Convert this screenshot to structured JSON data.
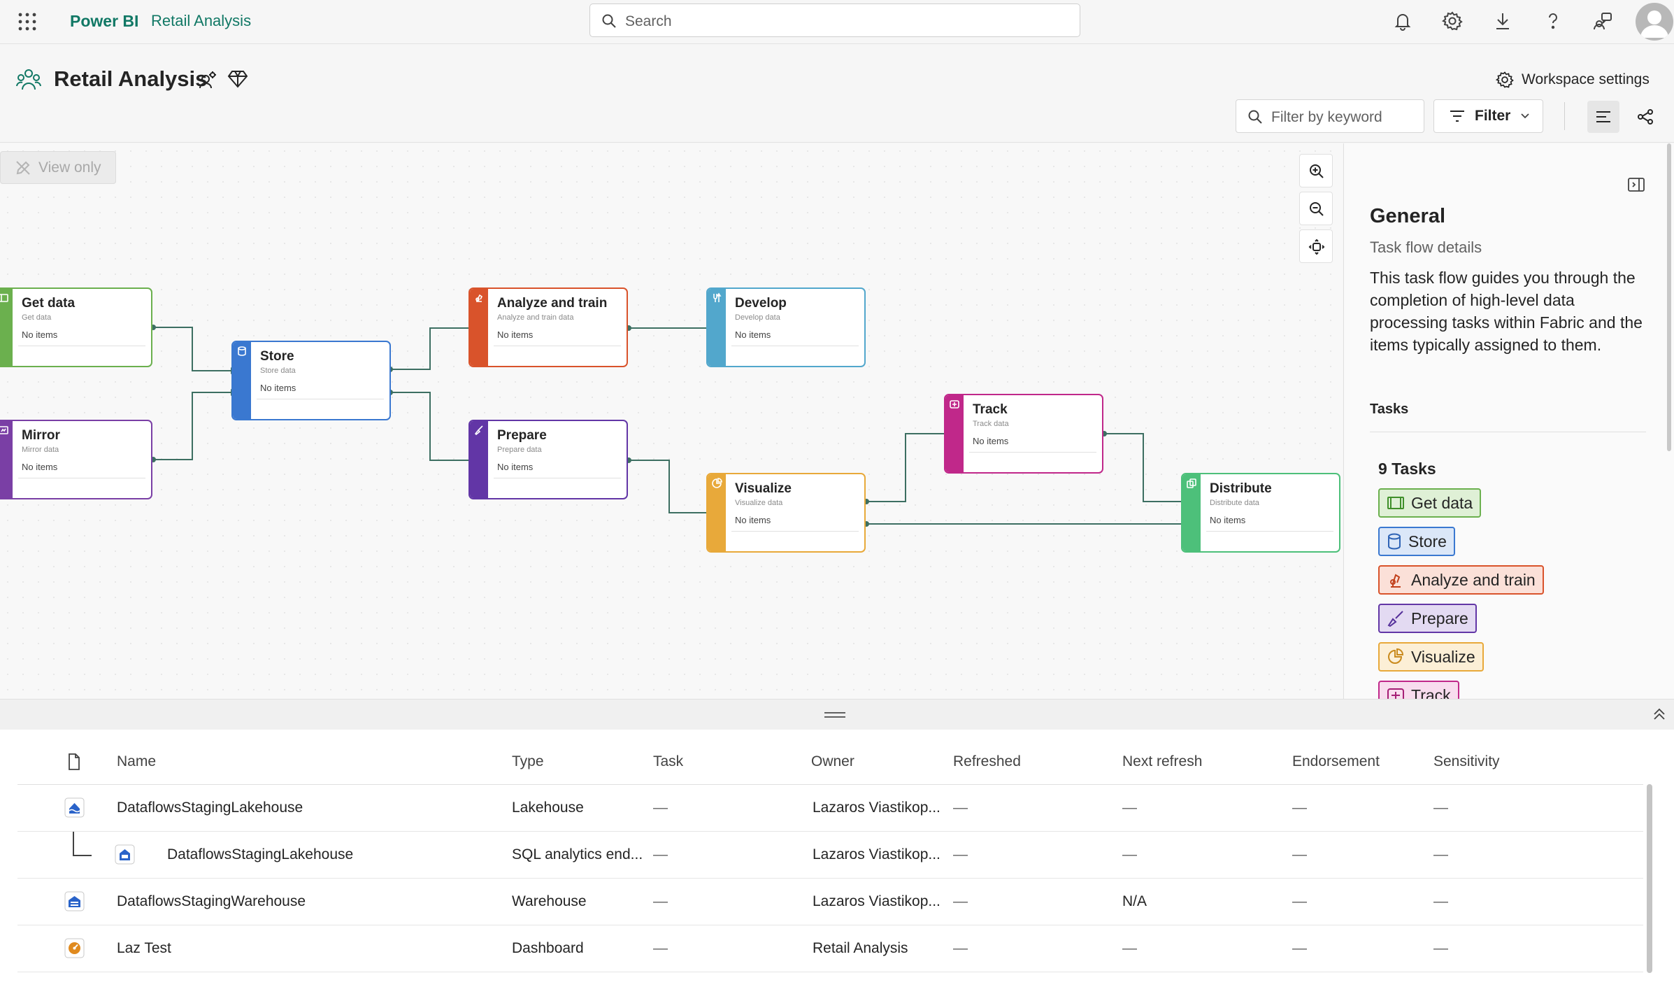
{
  "app": {
    "brand": "Power BI",
    "workspace": "Retail Analysis"
  },
  "search": {
    "placeholder": "Search"
  },
  "header": {
    "title": "Retail Analysis",
    "workspace_settings": "Workspace settings",
    "filter_placeholder": "Filter by keyword",
    "filter_label": "Filter"
  },
  "canvas": {
    "view_only": "View only",
    "tasks": [
      {
        "name": "Get data",
        "subtitle": "Get data",
        "items": "No items",
        "color": "#6bb04e",
        "icon": "get-data-icon"
      },
      {
        "name": "Mirror",
        "subtitle": "Mirror data",
        "items": "No items",
        "color": "#7a3fa5",
        "icon": "mirror-icon"
      },
      {
        "name": "Store",
        "subtitle": "Store data",
        "items": "No items",
        "color": "#3a78d0",
        "icon": "store-icon"
      },
      {
        "name": "Analyze and train",
        "subtitle": "Analyze and train data",
        "items": "No items",
        "color": "#d9532b",
        "icon": "analyze-icon"
      },
      {
        "name": "Prepare",
        "subtitle": "Prepare data",
        "items": "No items",
        "color": "#6236a6",
        "icon": "prepare-icon"
      },
      {
        "name": "Develop",
        "subtitle": "Develop data",
        "items": "No items",
        "color": "#52a7cc",
        "icon": "develop-icon"
      },
      {
        "name": "Visualize",
        "subtitle": "Visualize data",
        "items": "No items",
        "color": "#e8a93a",
        "icon": "visualize-icon"
      },
      {
        "name": "Track",
        "subtitle": "Track data",
        "items": "No items",
        "color": "#c0288a",
        "icon": "track-icon"
      },
      {
        "name": "Distribute",
        "subtitle": "Distribute data",
        "items": "No items",
        "color": "#4dc07a",
        "icon": "distribute-icon"
      }
    ]
  },
  "details": {
    "title": "General",
    "subtitle": "Task flow details",
    "description": "This task flow guides you through the completion of high-level data processing tasks within Fabric and the items typically assigned to them.",
    "tasks_heading": "Tasks",
    "tasks_count": "9 Tasks",
    "chips": [
      {
        "label": "Get data",
        "bg": "#dff0d6",
        "border": "#6bb04e"
      },
      {
        "label": "Store",
        "bg": "#dbe7f8",
        "border": "#3a78d0"
      },
      {
        "label": "Analyze and train",
        "bg": "#fbe0d8",
        "border": "#d9532b"
      },
      {
        "label": "Prepare",
        "bg": "#e3daf2",
        "border": "#6236a6"
      },
      {
        "label": "Visualize",
        "bg": "#fcefd6",
        "border": "#e8a93a"
      },
      {
        "label": "Track",
        "bg": "#f8dcee",
        "border": "#c0288a"
      }
    ]
  },
  "table": {
    "columns": [
      "Name",
      "Type",
      "Task",
      "Owner",
      "Refreshed",
      "Next refresh",
      "Endorsement",
      "Sensitivity"
    ],
    "rows": [
      {
        "name": "DataflowsStagingLakehouse",
        "type": "Lakehouse",
        "task": "—",
        "owner": "Lazaros Viastikop...",
        "refreshed": "—",
        "next": "—",
        "endorsement": "—",
        "sensitivity": "—",
        "icon": "lakehouse-icon"
      },
      {
        "name": "DataflowsStagingLakehouse",
        "type": "SQL analytics end...",
        "task": "—",
        "owner": "Lazaros Viastikop...",
        "refreshed": "—",
        "next": "—",
        "endorsement": "—",
        "sensitivity": "—",
        "icon": "sql-endpoint-icon"
      },
      {
        "name": "DataflowsStagingWarehouse",
        "type": "Warehouse",
        "task": "—",
        "owner": "Lazaros Viastikop...",
        "refreshed": "—",
        "next": "N/A",
        "endorsement": "—",
        "sensitivity": "—",
        "icon": "warehouse-icon"
      },
      {
        "name": "Laz Test",
        "type": "Dashboard",
        "task": "—",
        "owner": "Retail Analysis",
        "refreshed": "—",
        "next": "—",
        "endorsement": "—",
        "sensitivity": "—",
        "icon": "dashboard-icon"
      }
    ]
  }
}
